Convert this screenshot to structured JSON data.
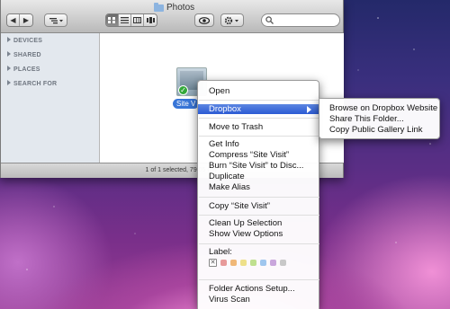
{
  "window": {
    "title": "Photos",
    "nav": {
      "back": "◀",
      "forward": "▶"
    },
    "arrange_icon": "arrange-icon",
    "view_modes": [
      "icon-view",
      "list-view",
      "column-view",
      "cover-flow-view"
    ],
    "quick_look_icon": "eye-icon",
    "action_icon": "gear-icon",
    "search_placeholder": "",
    "search_icon": "search-icon"
  },
  "sidebar": {
    "sections": [
      "DEVICES",
      "SHARED",
      "PLACES",
      "SEARCH FOR"
    ]
  },
  "file": {
    "label": "Site V",
    "badge": "✓"
  },
  "status": "1 of 1 selected, 79.05 GB",
  "context_menu": {
    "items": [
      "Open",
      "Dropbox",
      "Move to Trash",
      "Get Info",
      "Compress “Site Visit”",
      "Burn “Site Visit” to Disc...",
      "Duplicate",
      "Make Alias",
      "Copy “Site Visit”",
      "Clean Up Selection",
      "Show View Options",
      "Label:",
      "Folder Actions Setup...",
      "Virus Scan"
    ],
    "highlighted": "Dropbox",
    "label_colors": [
      "#e79a9a",
      "#f0b878",
      "#eee08a",
      "#bfe08f",
      "#9fc6ee",
      "#c9a6dc",
      "#c8c8c8"
    ],
    "label_none": "✕"
  },
  "submenu": {
    "items": [
      "Browse on Dropbox Website",
      "Share This Folder...",
      "Copy Public Gallery Link"
    ]
  }
}
